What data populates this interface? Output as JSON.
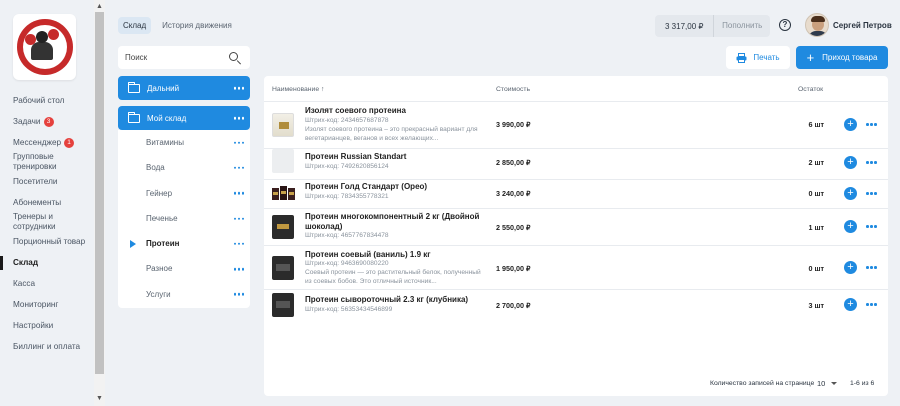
{
  "sidebar": {
    "items": [
      {
        "label": "Рабочий стол"
      },
      {
        "label": "Задачи",
        "badge": "3"
      },
      {
        "label": "Мессенджер",
        "badge": "1"
      },
      {
        "label": "Групповые тренировки"
      },
      {
        "label": "Посетители"
      },
      {
        "label": "Абонементы"
      },
      {
        "label": "Тренеры и сотрудники"
      },
      {
        "label": "Порционный товар"
      },
      {
        "label": "Склад"
      },
      {
        "label": "Касса"
      },
      {
        "label": "Мониторинг"
      },
      {
        "label": "Настройки"
      },
      {
        "label": "Биллинг и оплата"
      }
    ]
  },
  "tabs": [
    "Склад",
    "История движения"
  ],
  "header": {
    "balance": "3 317,00 ₽",
    "topup": "Пополнить",
    "help": "?",
    "user_name": "Сергей Петров"
  },
  "actions": {
    "print": "Печать",
    "add": "Приход товара"
  },
  "search": {
    "placeholder": "Поиск"
  },
  "folders": {
    "top": "Дальний",
    "current": "Мой склад",
    "subs": [
      "Витамины",
      "Вода",
      "Гейнер",
      "Печенье",
      "Протеин",
      "Разное",
      "Услуги"
    ],
    "active_sub": "Протеин"
  },
  "table": {
    "headers": {
      "name": "Наименование ↑",
      "cost": "Стоимость",
      "stock": "Остаток"
    },
    "rows": [
      {
        "name": "Изолят соевого протеина",
        "barcode": "Штрих-код: 2434657687878",
        "desc": "Изолят соевого протеина – это прекрасный вариант для вегетарианцев, веганов и всех желающих...",
        "price": "3 990,00 ₽",
        "qty": "6 шт",
        "thumb": "jar-white"
      },
      {
        "name": "Протеин Russian Standart",
        "barcode": "Штрих-код: 7492620856124",
        "desc": "",
        "price": "2 850,00 ₽",
        "qty": "2 шт",
        "thumb": "empty"
      },
      {
        "name": "Протеин Голд Стандарт (Орео)",
        "barcode": "Штрих-код: 7834355778321",
        "desc": "",
        "price": "3 240,00 ₽",
        "qty": "0 шт",
        "thumb": "tubs"
      },
      {
        "name": "Протеин многокомпонентный 2 кг (Двойной шоколад)",
        "barcode": "Штрих-код: 4657767834478",
        "desc": "",
        "price": "2 550,00 ₽",
        "qty": "1 шт",
        "thumb": "black"
      },
      {
        "name": "Протеин соевый (ваниль) 1.9 кг",
        "barcode": "Штрих-код: 9463690080220",
        "desc": "Соевый протеин — это растительный белок, полученный из соевых бобов. Это отличный источник...",
        "price": "1 950,00 ₽",
        "qty": "0 шт",
        "thumb": "black2"
      },
      {
        "name": "Протеин сывороточный 2.3 кг (клубника)",
        "barcode": "Штрих-код: 56353434546899",
        "desc": "",
        "price": "2 700,00 ₽",
        "qty": "3 шт",
        "thumb": "black2"
      }
    ]
  },
  "pagination": {
    "label": "Количество записей на странице",
    "per_page": "10",
    "range": "1-6 из 6"
  },
  "colors": {
    "accent": "#1f8ae0",
    "badge": "#e5413d",
    "background": "#eef1f5"
  }
}
